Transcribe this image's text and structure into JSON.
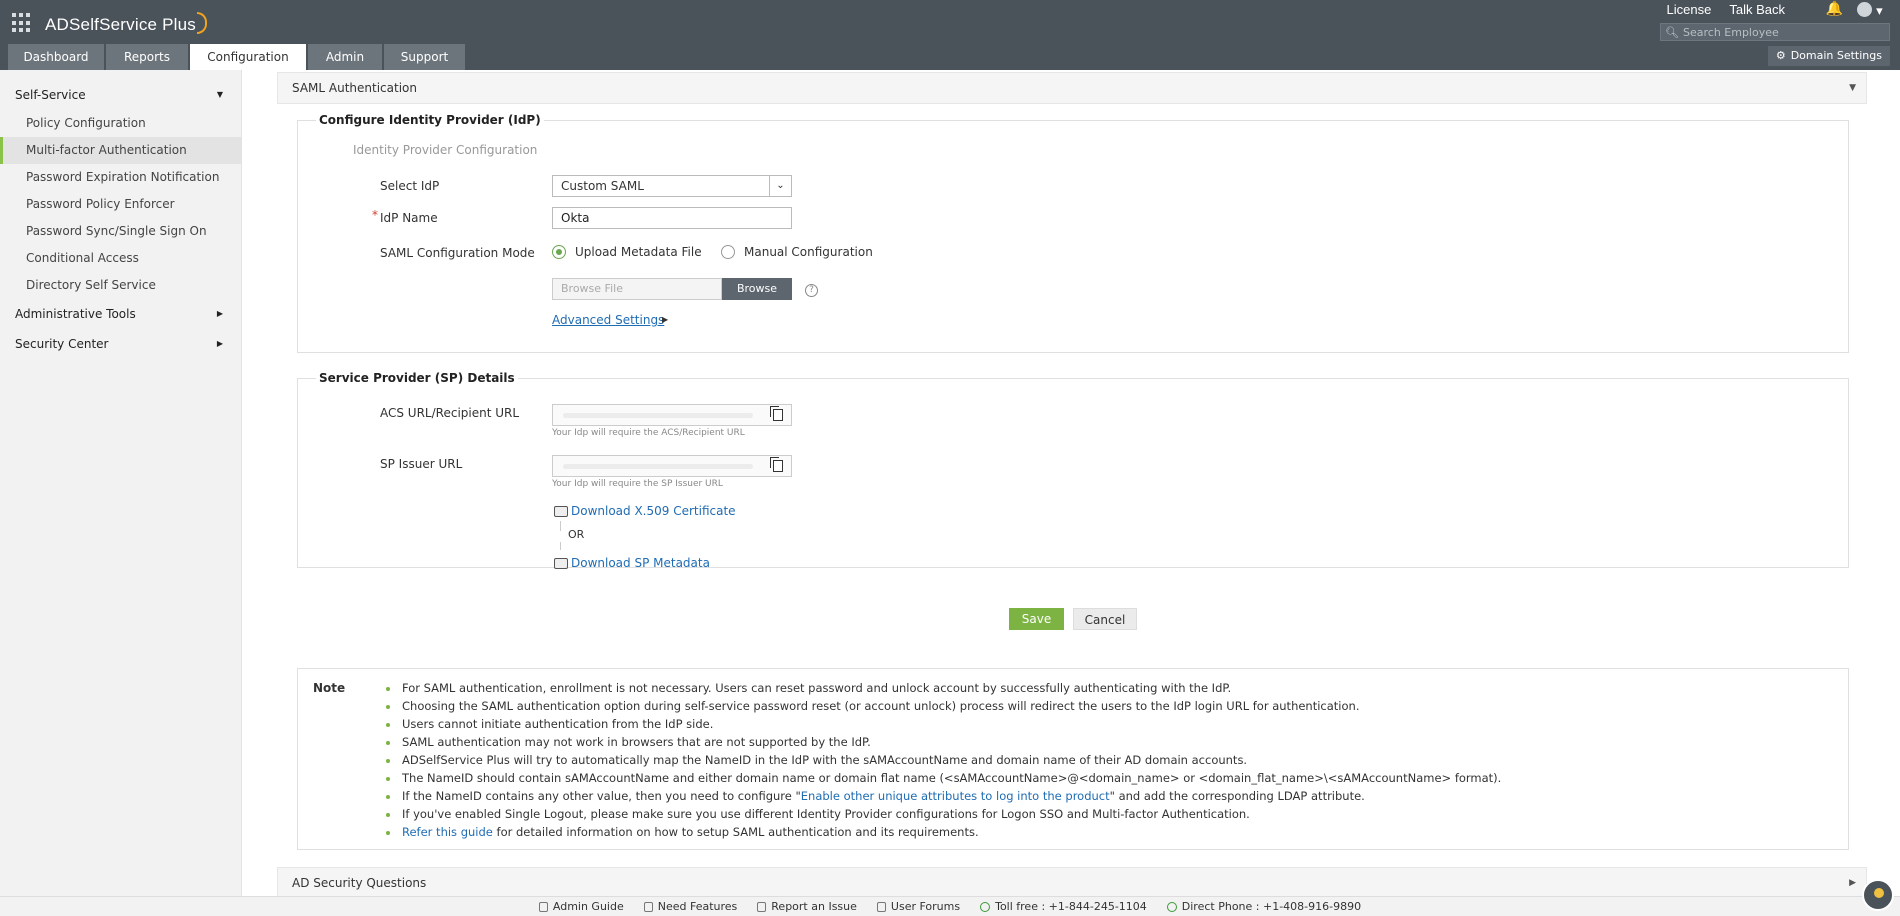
{
  "app": {
    "brand": "ADSelfService Plus"
  },
  "header": {
    "links": [
      "License",
      "Talk Back"
    ],
    "search_placeholder": "Search Employee",
    "domain_settings": "Domain Settings"
  },
  "tabs": [
    "Dashboard",
    "Reports",
    "Configuration",
    "Admin",
    "Support"
  ],
  "sidebar": {
    "group_self_service": "Self-Service",
    "items": [
      "Policy Configuration",
      "Multi-factor Authentication",
      "Password Expiration Notification",
      "Password Policy Enforcer",
      "Password Sync/Single Sign On",
      "Conditional Access",
      "Directory Self Service"
    ],
    "group_admin_tools": "Administrative Tools",
    "group_security": "Security Center"
  },
  "section": {
    "title": "SAML Authentication",
    "next_title": "AD Security Questions"
  },
  "idp": {
    "legend": "Configure Identity Provider (IdP)",
    "subtitle": "Identity Provider Configuration",
    "select_label": "Select IdP",
    "select_value": "Custom SAML",
    "name_label": "IdP Name",
    "name_value": "Okta",
    "mode_label": "SAML Configuration Mode",
    "mode_upload": "Upload Metadata File",
    "mode_manual": "Manual Configuration",
    "browse_placeholder": "Browse File",
    "browse_button": "Browse",
    "advanced": "Advanced Settings"
  },
  "sp": {
    "legend": "Service Provider (SP) Details",
    "acs_label": "ACS URL/Recipient URL",
    "acs_hint": "Your Idp will require the ACS/Recipient URL",
    "issuer_label": "SP Issuer URL",
    "issuer_hint": "Your Idp will require the SP Issuer URL",
    "download_cert": "Download X.509 Certificate",
    "or": "OR",
    "download_metadata": "Download SP Metadata"
  },
  "actions": {
    "save": "Save",
    "cancel": "Cancel"
  },
  "note": {
    "title": "Note",
    "items": [
      "For SAML authentication, enrollment is not necessary. Users can reset password and unlock account by successfully authenticating with the IdP.",
      "Choosing the SAML authentication option during self-service password reset (or account unlock) process will redirect the users to the IdP login URL for authentication.",
      "Users cannot initiate authentication from the IdP side.",
      "SAML authentication may not work in browsers that are not supported by the IdP.",
      "ADSelfService Plus will try to automatically map the NameID in the IdP with the sAMAccountName and domain name of their AD domain accounts.",
      "The NameID should contain sAMAccountName and either domain name or domain flat name (<sAMAccountName>@<domain_name> or <domain_flat_name>\\<sAMAccountName> format)."
    ],
    "item7_pre": "If the NameID contains any other value, then you need to configure \"",
    "item7_link": "Enable other unique attributes to log into the product",
    "item7_post": "\" and add the corresponding LDAP attribute.",
    "item8": "If you've enabled Single Logout, please make sure you use different Identity Provider configurations for Logon SSO and Multi-factor Authentication.",
    "item9_link": "Refer this guide",
    "item9_post": " for detailed information on how to setup SAML authentication and its requirements."
  },
  "footer": {
    "admin_guide": "Admin Guide",
    "need_features": "Need Features",
    "report_issue": "Report an Issue",
    "user_forums": "User Forums",
    "toll_free": "Toll free : +1-844-245-1104",
    "direct_phone": "Direct Phone : +1-408-916-9890"
  }
}
